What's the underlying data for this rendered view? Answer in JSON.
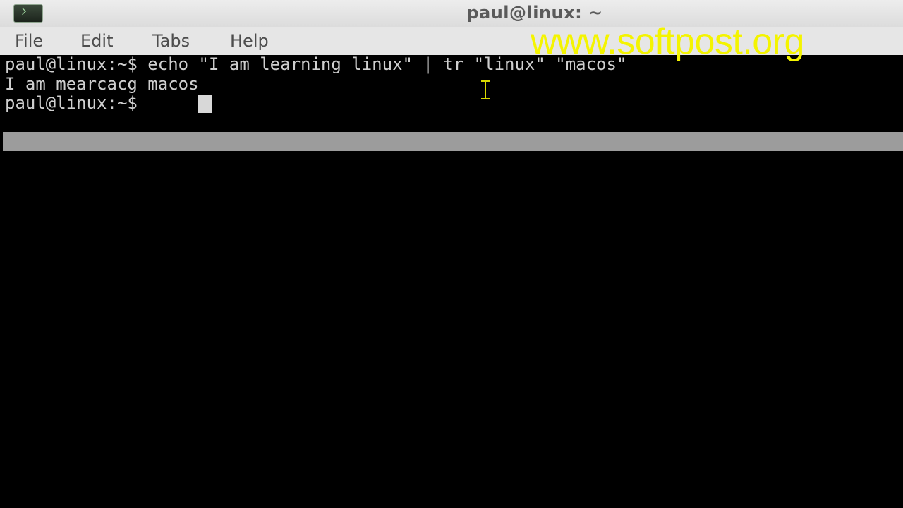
{
  "window": {
    "title": "paul@linux: ~"
  },
  "menu": {
    "file": "File",
    "edit": "Edit",
    "tabs": "Tabs",
    "help": "Help"
  },
  "watermark": "www.softpost.org",
  "terminal": {
    "lines": [
      "paul@linux:~$ echo \"I am learning linux\" | tr \"linux\" \"macos\"",
      "I am mearcacg macos",
      "paul@linux:~$ "
    ]
  },
  "colors": {
    "watermark": "#f4f400",
    "terminal_bg": "#000000",
    "terminal_text": "#cfcfcf"
  }
}
